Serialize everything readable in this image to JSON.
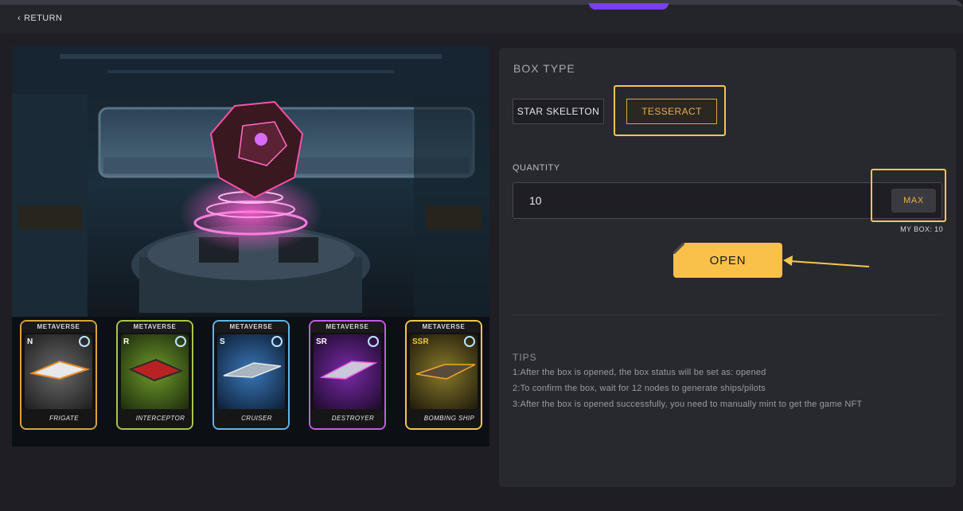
{
  "nav": {
    "return_label": "RETURN"
  },
  "showcase": {
    "cards": [
      {
        "banner": "METAVERSE",
        "rarity": "N",
        "name": "FRIGATE",
        "frame_color": "#d6a441",
        "art_color": "#4a4a4a"
      },
      {
        "banner": "METAVERSE",
        "rarity": "R",
        "name": "INTERCEPTOR",
        "frame_color": "#a9c64a",
        "art_color": "#4c6a1e"
      },
      {
        "banner": "METAVERSE",
        "rarity": "S",
        "name": "CRUISER",
        "frame_color": "#5fb6e8",
        "art_color": "#1f4a7a"
      },
      {
        "banner": "METAVERSE",
        "rarity": "SR",
        "name": "DESTROYER",
        "frame_color": "#c45ae8",
        "art_color": "#4a1f6a"
      },
      {
        "banner": "METAVERSE",
        "rarity": "SSR",
        "name": "BOMBING SHIP",
        "frame_color": "#f2c84a",
        "art_color": "#6a5a1a"
      }
    ]
  },
  "panel": {
    "title": "BOX TYPE",
    "box_types": [
      "STAR SKELETON",
      "TESSERACT"
    ],
    "selected_type": "TESSERACT",
    "quantity_label": "QUANTITY",
    "quantity_value": "10",
    "max_label": "MAX",
    "my_box": "MY BOX: 10",
    "open_label": "OPEN",
    "tips_title": "TIPS",
    "tips": [
      "1:After the box is opened, the box status will be set as: opened",
      "2:To confirm the box, wait for 12 nodes to generate ships/pilots",
      "3:After the box is opened successfully, you need to manually mint to get the game NFT"
    ]
  },
  "colors": {
    "accent": "#f9c04a",
    "highlight": "#f3c84b",
    "panel_bg": "#28282f",
    "page_bg": "#1e1e24"
  }
}
